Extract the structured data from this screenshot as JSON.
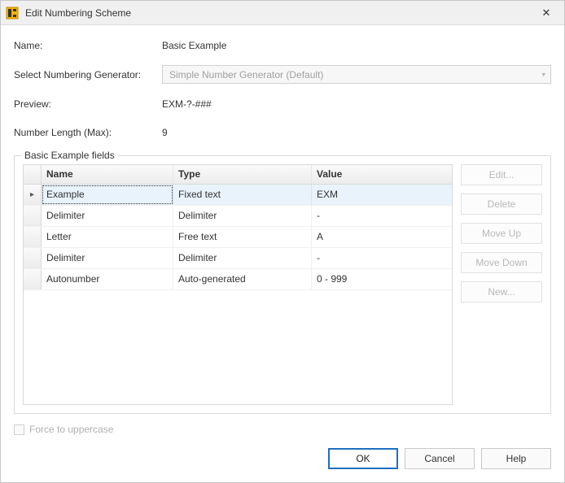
{
  "title": "Edit Numbering Scheme",
  "labels": {
    "name": "Name:",
    "generator": "Select Numbering Generator:",
    "preview": "Preview:",
    "length": "Number Length (Max):"
  },
  "values": {
    "name": "Basic Example",
    "generator_selected": "Simple Number Generator (Default)",
    "preview": "EXM-?-###",
    "length": "9"
  },
  "fieldset_legend": "Basic Example fields",
  "columns": {
    "name": "Name",
    "type": "Type",
    "value": "Value"
  },
  "rows": [
    {
      "name": "Example",
      "type": "Fixed text",
      "value": "EXM",
      "selected": true
    },
    {
      "name": "Delimiter",
      "type": "Delimiter",
      "value": "-",
      "selected": false
    },
    {
      "name": "Letter",
      "type": "Free text",
      "value": "A",
      "selected": false
    },
    {
      "name": "Delimiter",
      "type": "Delimiter",
      "value": "-",
      "selected": false
    },
    {
      "name": "Autonumber",
      "type": "Auto-generated",
      "value": "0 - 999",
      "selected": false
    }
  ],
  "side_buttons": {
    "edit": "Edit...",
    "delete": "Delete",
    "move_up": "Move Up",
    "move_down": "Move Down",
    "new": "New..."
  },
  "checkbox_label": "Force to uppercase",
  "footer": {
    "ok": "OK",
    "cancel": "Cancel",
    "help": "Help"
  }
}
